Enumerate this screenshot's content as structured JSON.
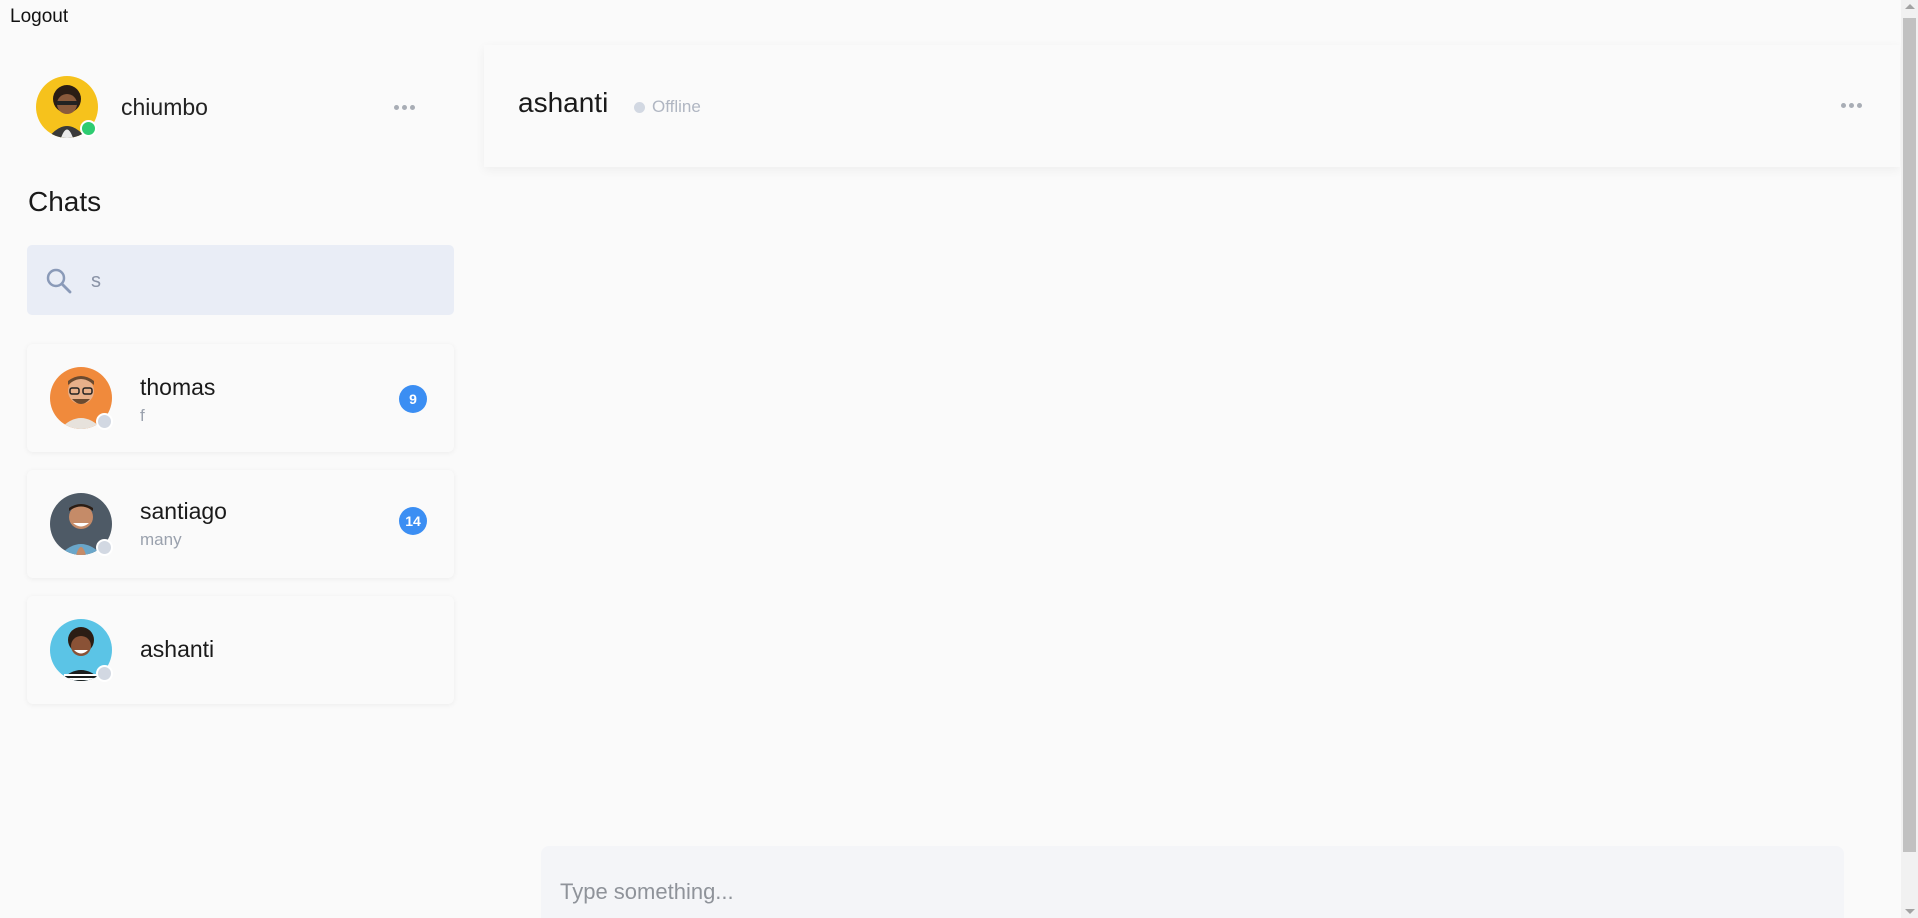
{
  "top": {
    "logout_label": "Logout"
  },
  "user": {
    "name": "chiumbo",
    "status_color": "#2ecc71"
  },
  "sidebar": {
    "title": "Chats",
    "search": {
      "value": "s",
      "placeholder": ""
    },
    "chats": [
      {
        "name": "thomas",
        "preview": "f",
        "unread": "9",
        "online": false
      },
      {
        "name": "santiago",
        "preview": "many",
        "unread": "14",
        "online": false
      },
      {
        "name": "ashanti",
        "preview": "",
        "unread": "",
        "online": false
      }
    ]
  },
  "conversation": {
    "title": "ashanti",
    "status": "Offline"
  },
  "composer": {
    "placeholder": "Type something..."
  },
  "colors": {
    "accent": "#3b8ef3",
    "online": "#2ecc71",
    "offline": "#d2d8e2",
    "search_bg": "#e9edf6"
  }
}
